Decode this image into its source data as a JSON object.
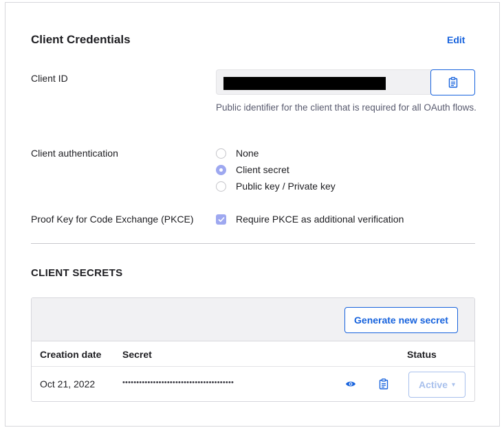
{
  "header": {
    "title": "Client Credentials",
    "edit_label": "Edit"
  },
  "client_id": {
    "label": "Client ID",
    "value": "",
    "help_text": "Public identifier for the client that is required for all OAuth flows."
  },
  "client_auth": {
    "label": "Client authentication",
    "options": [
      {
        "label": "None",
        "checked": false
      },
      {
        "label": "Client secret",
        "checked": true
      },
      {
        "label": "Public key / Private key",
        "checked": false
      }
    ]
  },
  "pkce": {
    "label": "Proof Key for Code Exchange (PKCE)",
    "checkbox_label": "Require PKCE as additional verification",
    "checked": true
  },
  "client_secrets": {
    "section_title": "CLIENT SECRETS",
    "generate_label": "Generate new secret",
    "columns": [
      "Creation date",
      "Secret",
      "Status"
    ],
    "rows": [
      {
        "creation_date": "Oct 21, 2022",
        "secret": "••••••••••••••••••••••••••••••••••••••••",
        "status": "Active",
        "caret": "▾"
      }
    ]
  },
  "colors": {
    "accent": "#1662dd",
    "control_checked": "#9ea8f0",
    "status_disabled": "#a8c0ec"
  },
  "icons": {
    "copy": "clipboard-icon",
    "reveal": "eye-icon"
  }
}
